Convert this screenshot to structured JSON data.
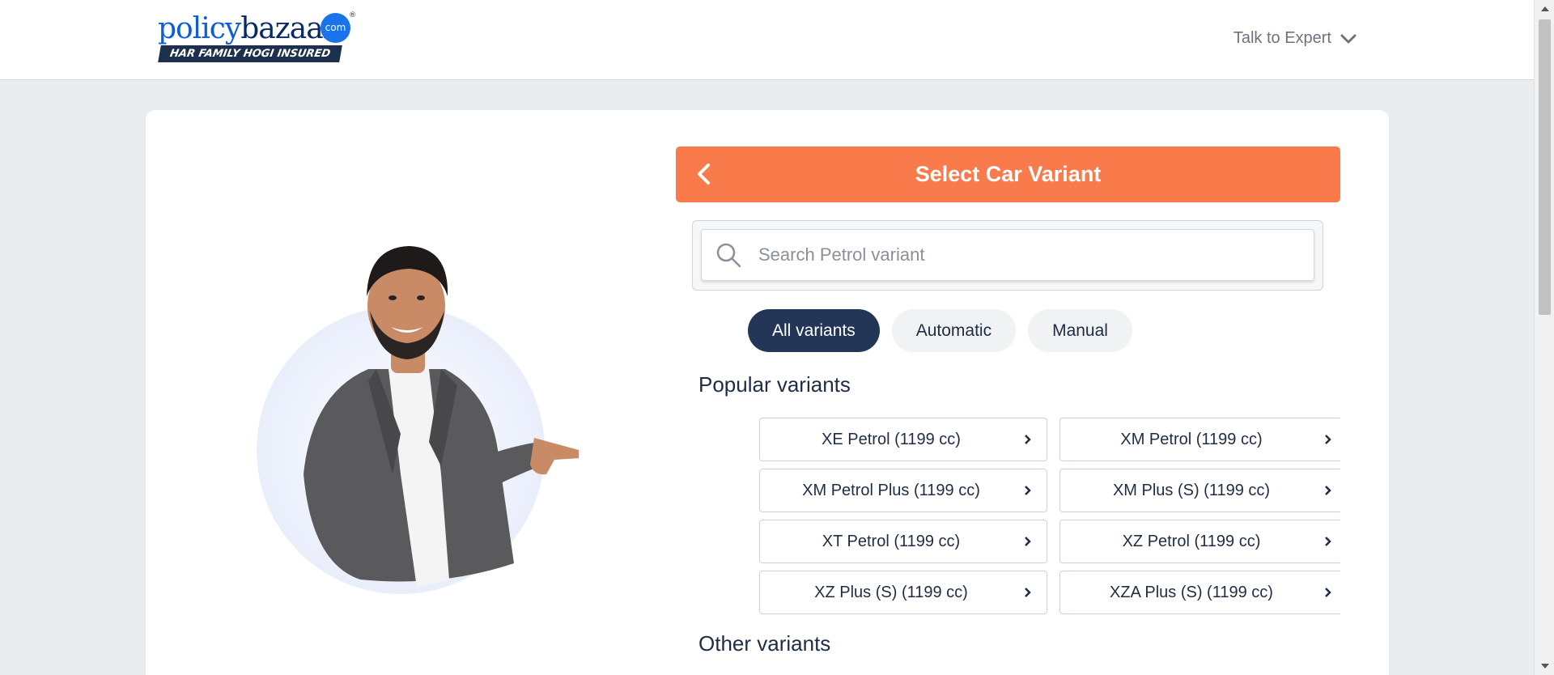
{
  "header": {
    "logo": {
      "part1": "policy",
      "part2": "bazaar",
      "dot_text": "com",
      "registered": "®",
      "tagline": "HAR FAMILY HOGI INSURED"
    },
    "talk_to_expert": "Talk to Expert"
  },
  "panel": {
    "title": "Select Car Variant",
    "search_placeholder": "Search Petrol variant",
    "tabs": [
      {
        "label": "All variants",
        "active": true
      },
      {
        "label": "Automatic",
        "active": false
      },
      {
        "label": "Manual",
        "active": false
      }
    ],
    "popular_title": "Popular variants",
    "popular_variants": [
      "XE Petrol (1199 cc)",
      "XM Petrol (1199 cc)",
      "XM Petrol Plus (1199 cc)",
      "XM Plus (S) (1199 cc)",
      "XT Petrol (1199 cc)",
      "XZ Petrol (1199 cc)",
      "XZ Plus (S) (1199 cc)",
      "XZA Plus (S) (1199 cc)"
    ],
    "other_title": "Other variants"
  },
  "colors": {
    "accent": "#f97a4b",
    "navy": "#233657",
    "text": "#1f2d44",
    "page_bg": "#e8ecef"
  }
}
